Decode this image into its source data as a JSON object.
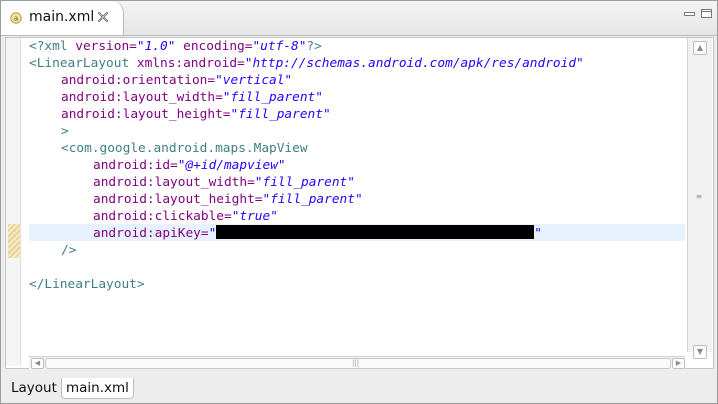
{
  "tab": {
    "title": "main.xml",
    "icon": "xml-file-icon"
  },
  "window_controls": {
    "minimize": "minimize-icon",
    "maximize": "maximize-icon"
  },
  "code": {
    "line1": {
      "open": "<?xml ",
      "attr1": "version=",
      "val1": "\"1.0\"",
      "sp": " ",
      "attr2": "encoding=",
      "val2": "\"utf-8\"",
      "close": "?>"
    },
    "line2": {
      "tag": "<LinearLayout ",
      "attr": "xmlns:android=",
      "val": "\"http://schemas.android.com/apk/res/android\""
    },
    "line3": {
      "attr": "android:orientation=",
      "val": "\"vertical\""
    },
    "line4": {
      "attr": "android:layout_width=",
      "val": "\"fill_parent\""
    },
    "line5": {
      "attr": "android:layout_height=",
      "val": "\"fill_parent\""
    },
    "line6": {
      "tag": ">"
    },
    "line7": {
      "tag": "<com.google.android.maps.MapView"
    },
    "line8": {
      "attr": "android:id=",
      "val": "\"@+id/mapview\""
    },
    "line9": {
      "attr": "android:layout_width=",
      "val": "\"fill_parent\""
    },
    "line10": {
      "attr": "android:layout_height=",
      "val": "\"fill_parent\""
    },
    "line11": {
      "attr": "android:clickable=",
      "val": "\"true\""
    },
    "line12": {
      "attr": "android:apiKey=",
      "quote_open": "\"",
      "quote_close": "\""
    },
    "line13": {
      "tag": "/>"
    },
    "line15": {
      "tag": "</LinearLayout>"
    }
  },
  "bottom_tabs": [
    "Layout",
    "main.xml"
  ],
  "colors": {
    "tag": "#3f7f7f",
    "attribute": "#7f007f",
    "value": "#2a00ff",
    "current_line": "#e8f2fe"
  }
}
